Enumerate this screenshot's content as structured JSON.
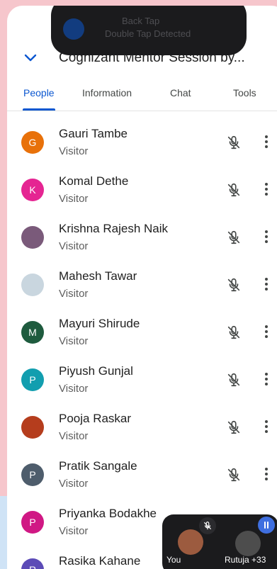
{
  "toast": {
    "line1": "Back Tap",
    "line2": "Double Tap Detected"
  },
  "header": {
    "title": "Cognizant Mentor Session by..."
  },
  "tabs": [
    {
      "label": "People",
      "active": true
    },
    {
      "label": "Information",
      "active": false
    },
    {
      "label": "Chat",
      "active": false
    },
    {
      "label": "Tools",
      "active": false
    }
  ],
  "participants": [
    {
      "initial": "G",
      "name": "Gauri Tambe",
      "role": "Visitor",
      "avatar_color": "#e8710a",
      "photo": false
    },
    {
      "initial": "K",
      "name": "Komal Dethe",
      "role": "Visitor",
      "avatar_color": "#e52592",
      "photo": false
    },
    {
      "initial": "",
      "name": "Krishna Rajesh Naik",
      "role": "Visitor",
      "avatar_color": "#7a5a7a",
      "photo": true
    },
    {
      "initial": "",
      "name": "Mahesh Tawar",
      "role": "Visitor",
      "avatar_color": "#c9d6df",
      "photo": true
    },
    {
      "initial": "M",
      "name": "Mayuri Shirude",
      "role": "Visitor",
      "avatar_color": "#1e5b3e",
      "photo": false
    },
    {
      "initial": "P",
      "name": "Piyush Gunjal",
      "role": "Visitor",
      "avatar_color": "#129eaf",
      "photo": false
    },
    {
      "initial": "",
      "name": "Pooja Raskar",
      "role": "Visitor",
      "avatar_color": "#b53d1d",
      "photo": true
    },
    {
      "initial": "P",
      "name": "Pratik Sangale",
      "role": "Visitor",
      "avatar_color": "#4e5d6c",
      "photo": false
    },
    {
      "initial": "P",
      "name": "Priyanka Bodakhe",
      "role": "Visitor",
      "avatar_color": "#d01884",
      "photo": false
    },
    {
      "initial": "R",
      "name": "Rasika Kahane",
      "role": "",
      "avatar_color": "#5c4bb7",
      "photo": false
    }
  ],
  "pip": {
    "self_label": "You",
    "other_label": "Rutuja",
    "extra_count": "+33"
  },
  "colors": {
    "accent": "#0b57d0",
    "frame": "#f6c6cc"
  },
  "icons": {
    "collapse": "chevron-down-icon",
    "mic": "mic-off-icon",
    "menu": "more-vert-icon"
  }
}
